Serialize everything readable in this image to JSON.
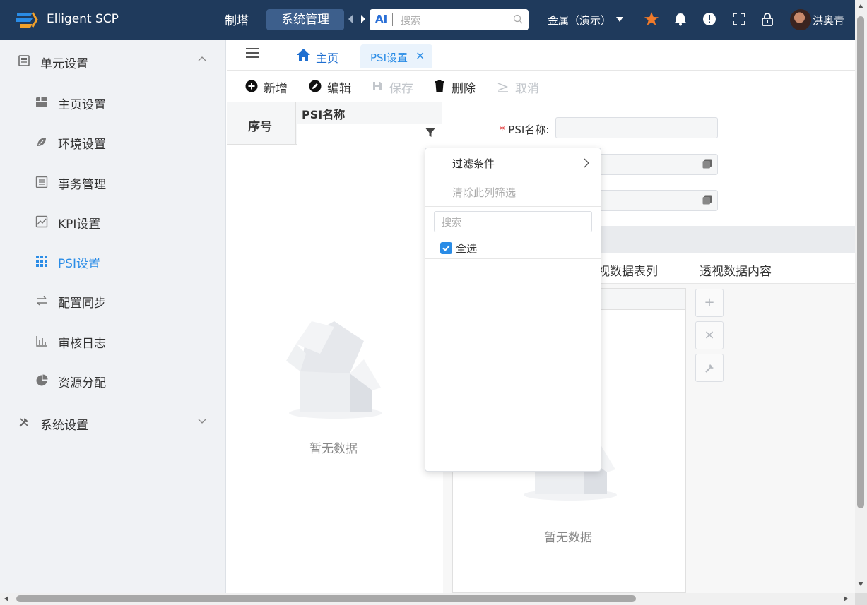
{
  "app": {
    "brand": "Elligent SCP"
  },
  "topnav": {
    "partial_item": "制塔",
    "active_item": "系统管理",
    "search_ai_label": "AI",
    "search_placeholder": "搜索",
    "tenant": "金属（演示）",
    "username": "洪奥青"
  },
  "sidebar": {
    "group_unit": "单元设置",
    "items": [
      {
        "label": "主页设置",
        "icon": "home-settings-icon"
      },
      {
        "label": "环境设置",
        "icon": "leaf-icon"
      },
      {
        "label": "事务管理",
        "icon": "list-icon"
      },
      {
        "label": "KPI设置",
        "icon": "chart-line-icon"
      },
      {
        "label": "PSI设置",
        "icon": "grid-icon",
        "active": true
      },
      {
        "label": "配置同步",
        "icon": "swap-icon"
      },
      {
        "label": "审核日志",
        "icon": "bar-chart-icon"
      },
      {
        "label": "资源分配",
        "icon": "pie-chart-icon"
      }
    ],
    "group_system": "系统设置"
  },
  "tabs": {
    "home": "主页",
    "psi": "PSI设置",
    "close": "×"
  },
  "toolbar": {
    "add": "新增",
    "edit": "编辑",
    "save": "保存",
    "delete": "删除",
    "cancel": "取消"
  },
  "grid": {
    "col_seq": "序号",
    "col_name": "PSI名称",
    "empty": "暂无数据"
  },
  "form": {
    "required_mark": "*",
    "psi_name_label": "PSI名称:"
  },
  "pivot": {
    "tab_columns_partial": "视数据表列",
    "tab_content": "透视数据内容",
    "empty": "暂无数据",
    "add_symbol": "+",
    "remove_symbol": "×"
  },
  "dropdown": {
    "filter_conditions": "过滤条件",
    "clear_filter": "清除此列筛选",
    "search_placeholder": "搜索",
    "select_all": "全选"
  },
  "colors": {
    "topbar": "#1f3a5c",
    "accent": "#2a8ce6",
    "star": "#f07a2a"
  }
}
